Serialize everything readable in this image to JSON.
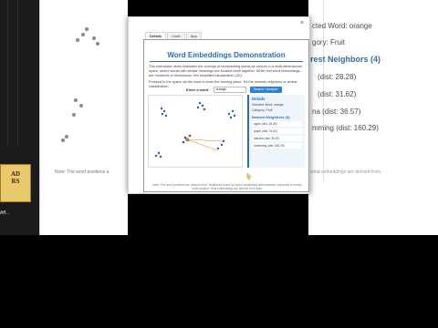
{
  "modal": {
    "close_label": "×",
    "tabs": [
      "Details",
      "Code",
      "App"
    ],
    "active_tab": "Details"
  },
  "demo": {
    "title": "Word Embeddings Demonstration",
    "description": "This interactive demo illustrates the concept of representing words as vectors in a multi-dimensional space, where words with similar meanings are located close together. While real word embeddings are hundreds of dimensions, this simplified visualization (2D).",
    "instructions": "Proceed to the space via the word to learn the forming plane. It's the nearest neighbors or similar classification.",
    "controls": {
      "label": "Enter a word:",
      "input_value": "orange",
      "button": "Search / Analyze"
    },
    "details": {
      "heading": "Details",
      "selected": "Selected Word: orange",
      "category": "Category: Fruit",
      "neighbors_heading": "Nearest Neighbors (4)",
      "neighbors": [
        "apple (dist: 28.28)",
        "grape (dist: 31.62)",
        "banana (dist: 36.57)",
        "swimming (dist: 160.29)"
      ]
    },
    "footnote": "Note: The word positions are random here. Neighbors found by vector positioning demonstration purposes to render hotel product. Real embeddings are derived from data."
  },
  "right_page": {
    "line1": "cted Word: orange",
    "line2": "gory: Fruit",
    "heading": "rest Neighbors (4)",
    "n1": "(dist: 28.28)",
    "n2": "(dist: 31.62)",
    "n3": "na (dist: 36.57)",
    "n4": "mming (dist: 160.29)",
    "note": "what embeddings are derived from"
  },
  "left_page": {
    "note": "Note: The word positions a",
    "thumb_text": "AD\nRS",
    "mini_label": "Aff..."
  },
  "colors": {
    "accent": "#2a6db5",
    "button": "#2a82d8",
    "points": "#2b5fa0",
    "highlight": "#e07a1f"
  }
}
